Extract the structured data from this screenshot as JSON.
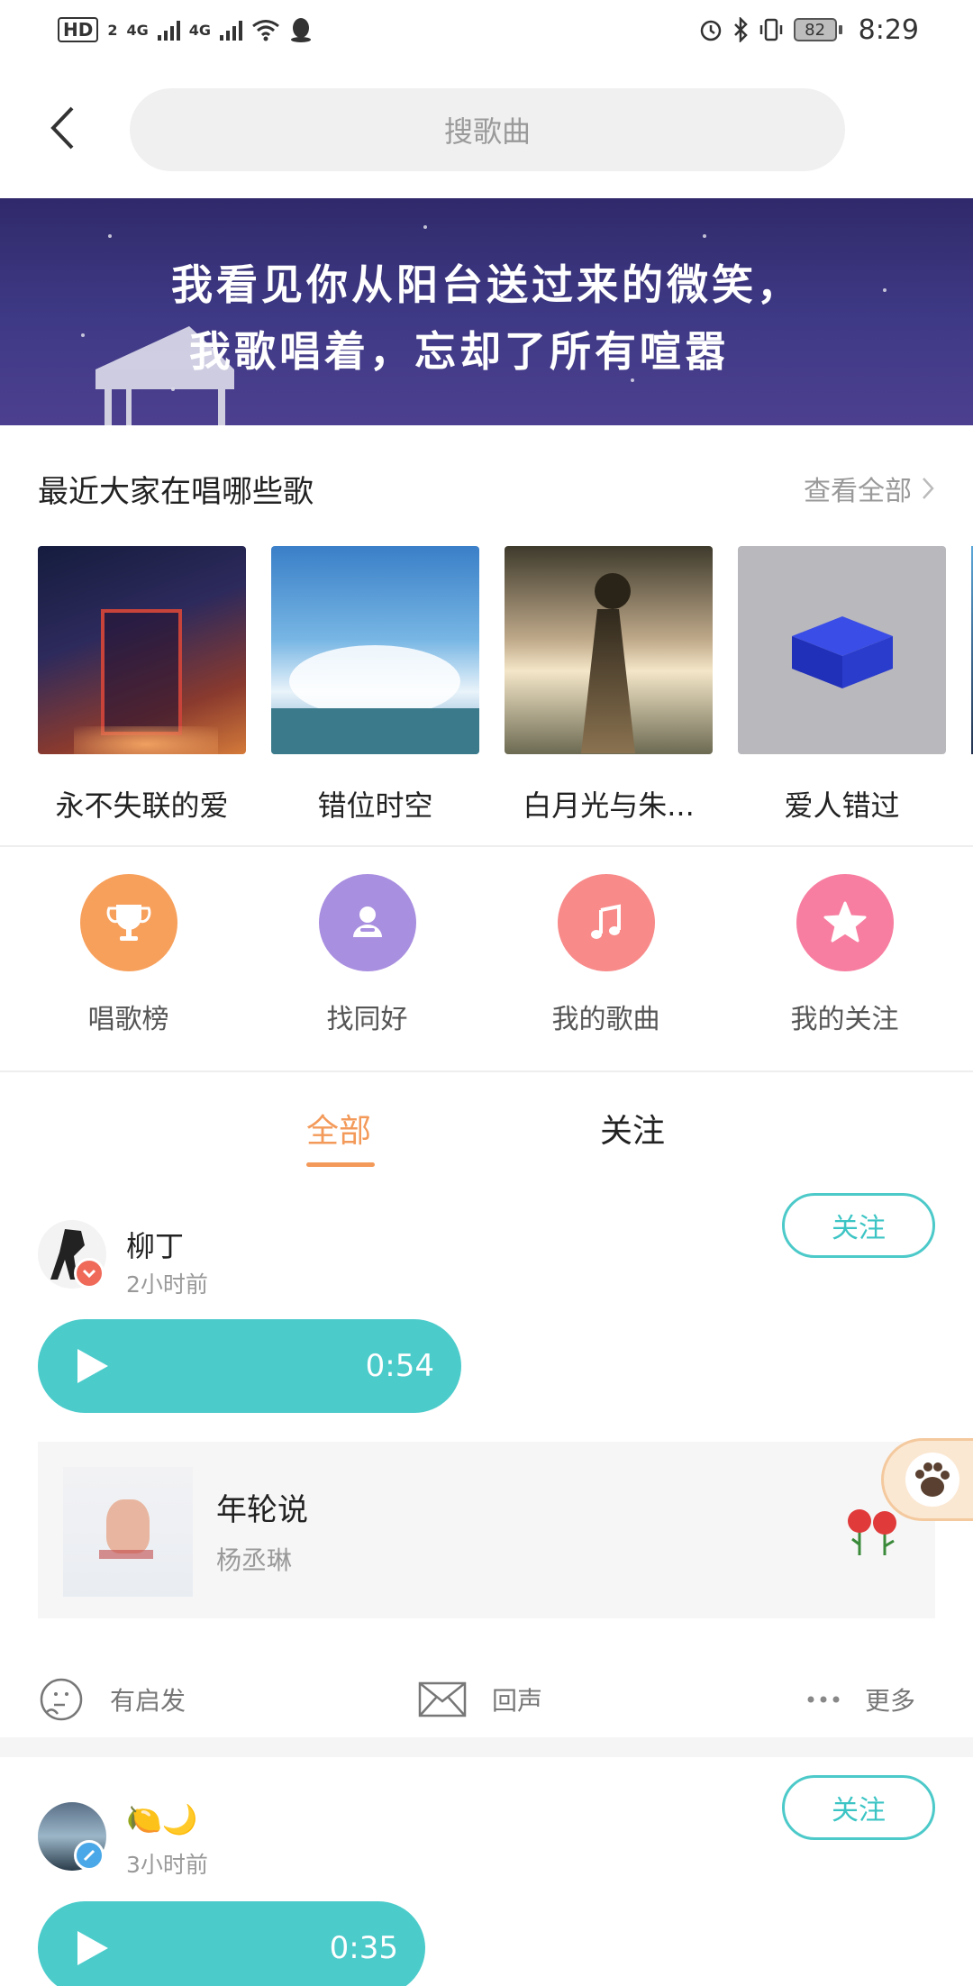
{
  "status_bar": {
    "hd": "HD",
    "sim": "2",
    "net1": "4G",
    "net2": "4G",
    "battery": "82",
    "time": "8:29"
  },
  "header": {
    "search_placeholder": "搜歌曲"
  },
  "banner": {
    "line1": "我看见你从阳台送过来的微笑，",
    "line2": "我歌唱着，忘却了所有喧嚣"
  },
  "recent": {
    "title": "最近大家在唱哪些歌",
    "more": "查看全部",
    "songs": [
      {
        "name": "永不失联的爱"
      },
      {
        "name": "错位时空"
      },
      {
        "name": "白月光与朱..."
      },
      {
        "name": "爱人错过"
      }
    ]
  },
  "quick": [
    {
      "label": "唱歌榜",
      "color": "#f7a05c",
      "icon": "trophy-icon"
    },
    {
      "label": "找同好",
      "color": "#a98fe0",
      "icon": "people-icon"
    },
    {
      "label": "我的歌曲",
      "color": "#f88a8a",
      "icon": "music-note-icon"
    },
    {
      "label": "我的关注",
      "color": "#f77ea0",
      "icon": "star-icon"
    }
  ],
  "tabs": {
    "all": "全部",
    "follow": "关注"
  },
  "posts": [
    {
      "user": "柳丁",
      "time": "2小时前",
      "follow": "关注",
      "duration": "0:54",
      "song_title": "年轮说",
      "song_artist": "杨丞琳",
      "action_inspire": "有启发",
      "action_echo": "回声",
      "action_more": "更多"
    },
    {
      "user": "🍋🌙",
      "time": "3小时前",
      "follow": "关注",
      "duration": "0:35"
    }
  ]
}
